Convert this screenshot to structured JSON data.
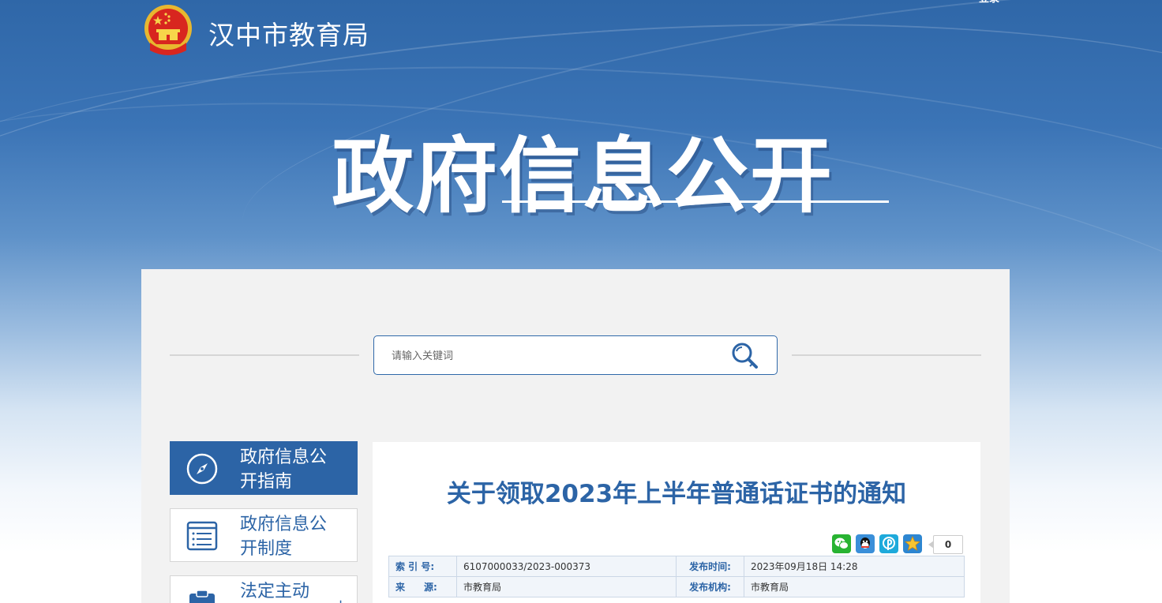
{
  "header": {
    "site_name": "汉中市教育局",
    "corner_text": "登录",
    "banner_title": "政府信息公开",
    "emblem_icon": "national-emblem-icon"
  },
  "search": {
    "placeholder": "请输入关键词",
    "button_icon": "search-icon"
  },
  "sidebar": {
    "items": [
      {
        "label": "政府信息公开指南",
        "icon": "compass-icon",
        "active": true
      },
      {
        "label": "政府信息公开制度",
        "icon": "document-list-icon",
        "active": false
      },
      {
        "label": "法定主动",
        "icon": "clipboard-icon",
        "active": false,
        "expand": "+"
      }
    ]
  },
  "article": {
    "title": "关于领取2023年上半年普通话证书的通知",
    "share": {
      "icons": [
        "wechat-icon",
        "qq-icon",
        "qzone-icon",
        "favorite-star-icon"
      ],
      "count": "0"
    },
    "meta": {
      "index_label": "索 引 号:",
      "index_value": "6107000033/2023-000373",
      "publish_time_label": "发布时间:",
      "publish_time_value": "2023年09月18日 14:28",
      "source_label": "来　　源:",
      "source_value": "市教育局",
      "publisher_label": "发布机构:",
      "publisher_value": "市教育局"
    }
  },
  "colors": {
    "primary": "#2c64a6",
    "panel_bg": "#f2f2f2",
    "banner_top": "#2f67a8"
  }
}
